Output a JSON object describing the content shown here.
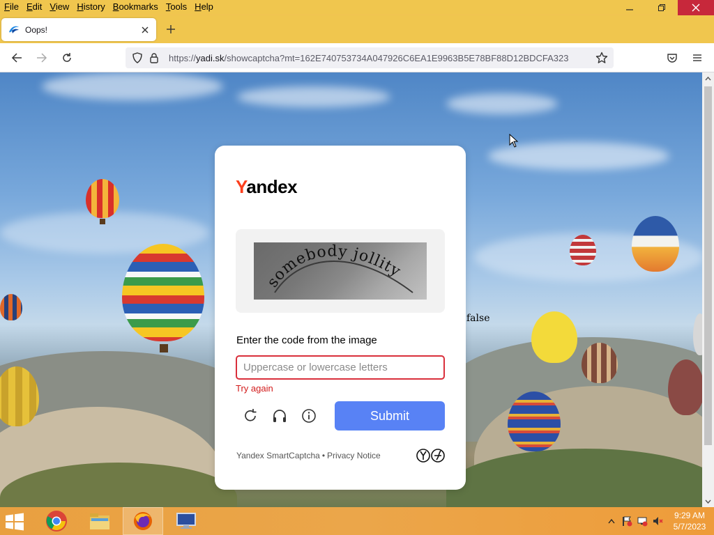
{
  "browser": {
    "menu": [
      {
        "label": "File",
        "accel": "F",
        "rest": "ile"
      },
      {
        "label": "Edit",
        "accel": "E",
        "rest": "dit"
      },
      {
        "label": "View",
        "accel": "V",
        "rest": "iew"
      },
      {
        "label": "History",
        "accel": "H",
        "rest": "istory"
      },
      {
        "label": "Bookmarks",
        "accel": "B",
        "rest": "ookmarks"
      },
      {
        "label": "Tools",
        "accel": "T",
        "rest": "ools"
      },
      {
        "label": "Help",
        "accel": "H",
        "rest": "elp"
      }
    ],
    "tab": {
      "title": "Oops!"
    },
    "url": {
      "scheme": "https://",
      "host": "yadi.sk",
      "path": "/showcaptcha?mt=162E740753734A047926C6EA1E9963B5E78BF88D12BDCFA323"
    }
  },
  "page": {
    "stray_text": "false"
  },
  "captcha": {
    "logo_first": "Y",
    "logo_rest": "andex",
    "captcha_text": "somebody jollity",
    "prompt": "Enter the code from the image",
    "input_placeholder": "Uppercase or lowercase letters",
    "input_value": "",
    "error": "Try again",
    "submit_label": "Submit",
    "footer_brand": "Yandex SmartCaptcha",
    "footer_sep": "•",
    "footer_link": "Privacy Notice"
  },
  "taskbar": {
    "time": "9:29 AM",
    "date": "5/7/2023"
  },
  "colors": {
    "brand_red": "#fc3f1d",
    "submit_blue": "#5882f5",
    "error_red": "#d21a1a",
    "browser_chrome": "#f0c64e"
  }
}
